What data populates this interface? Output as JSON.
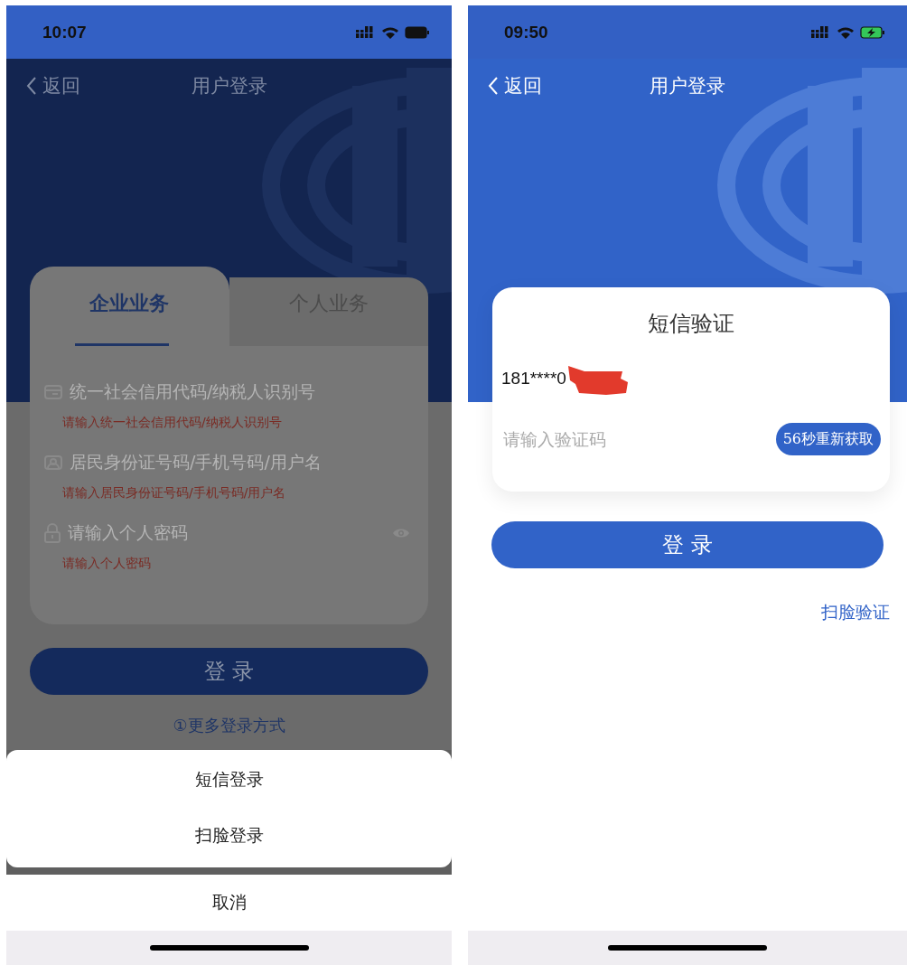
{
  "left_screen": {
    "dimmed": true,
    "status_bar": {
      "time": "10:07",
      "charging": false
    },
    "nav": {
      "back": "返回",
      "title": "用户登录"
    },
    "tabs": [
      {
        "label": "企业业务",
        "selected": true
      },
      {
        "label": "个人业务",
        "selected": false
      }
    ],
    "fields": [
      {
        "kind": "card",
        "placeholder": "统一社会信用代码/纳税人识别号",
        "error": "请输入统一社会信用代码/纳税人识别号"
      },
      {
        "kind": "person",
        "placeholder": "居民身份证号码/手机号码/用户名",
        "error": "请输入居民身份证号码/手机号码/用户名"
      },
      {
        "kind": "password",
        "placeholder": "请输入个人密码",
        "error": "请输入个人密码"
      }
    ],
    "login_button": "登 录",
    "more_link": "①更多登录方式",
    "action_sheet": {
      "options": [
        "短信登录",
        "扫脸登录"
      ],
      "cancel": "取消"
    }
  },
  "right_screen": {
    "status_bar": {
      "time": "09:50",
      "charging": true
    },
    "nav": {
      "back": "返回",
      "title": "用户登录"
    },
    "card_title": "短信验证",
    "phone": "181****0",
    "code_field": {
      "placeholder": "请输入验证码"
    },
    "resend_button": "56秒重新获取",
    "login_button": "登 录",
    "face_link": "扫脸验证"
  }
}
